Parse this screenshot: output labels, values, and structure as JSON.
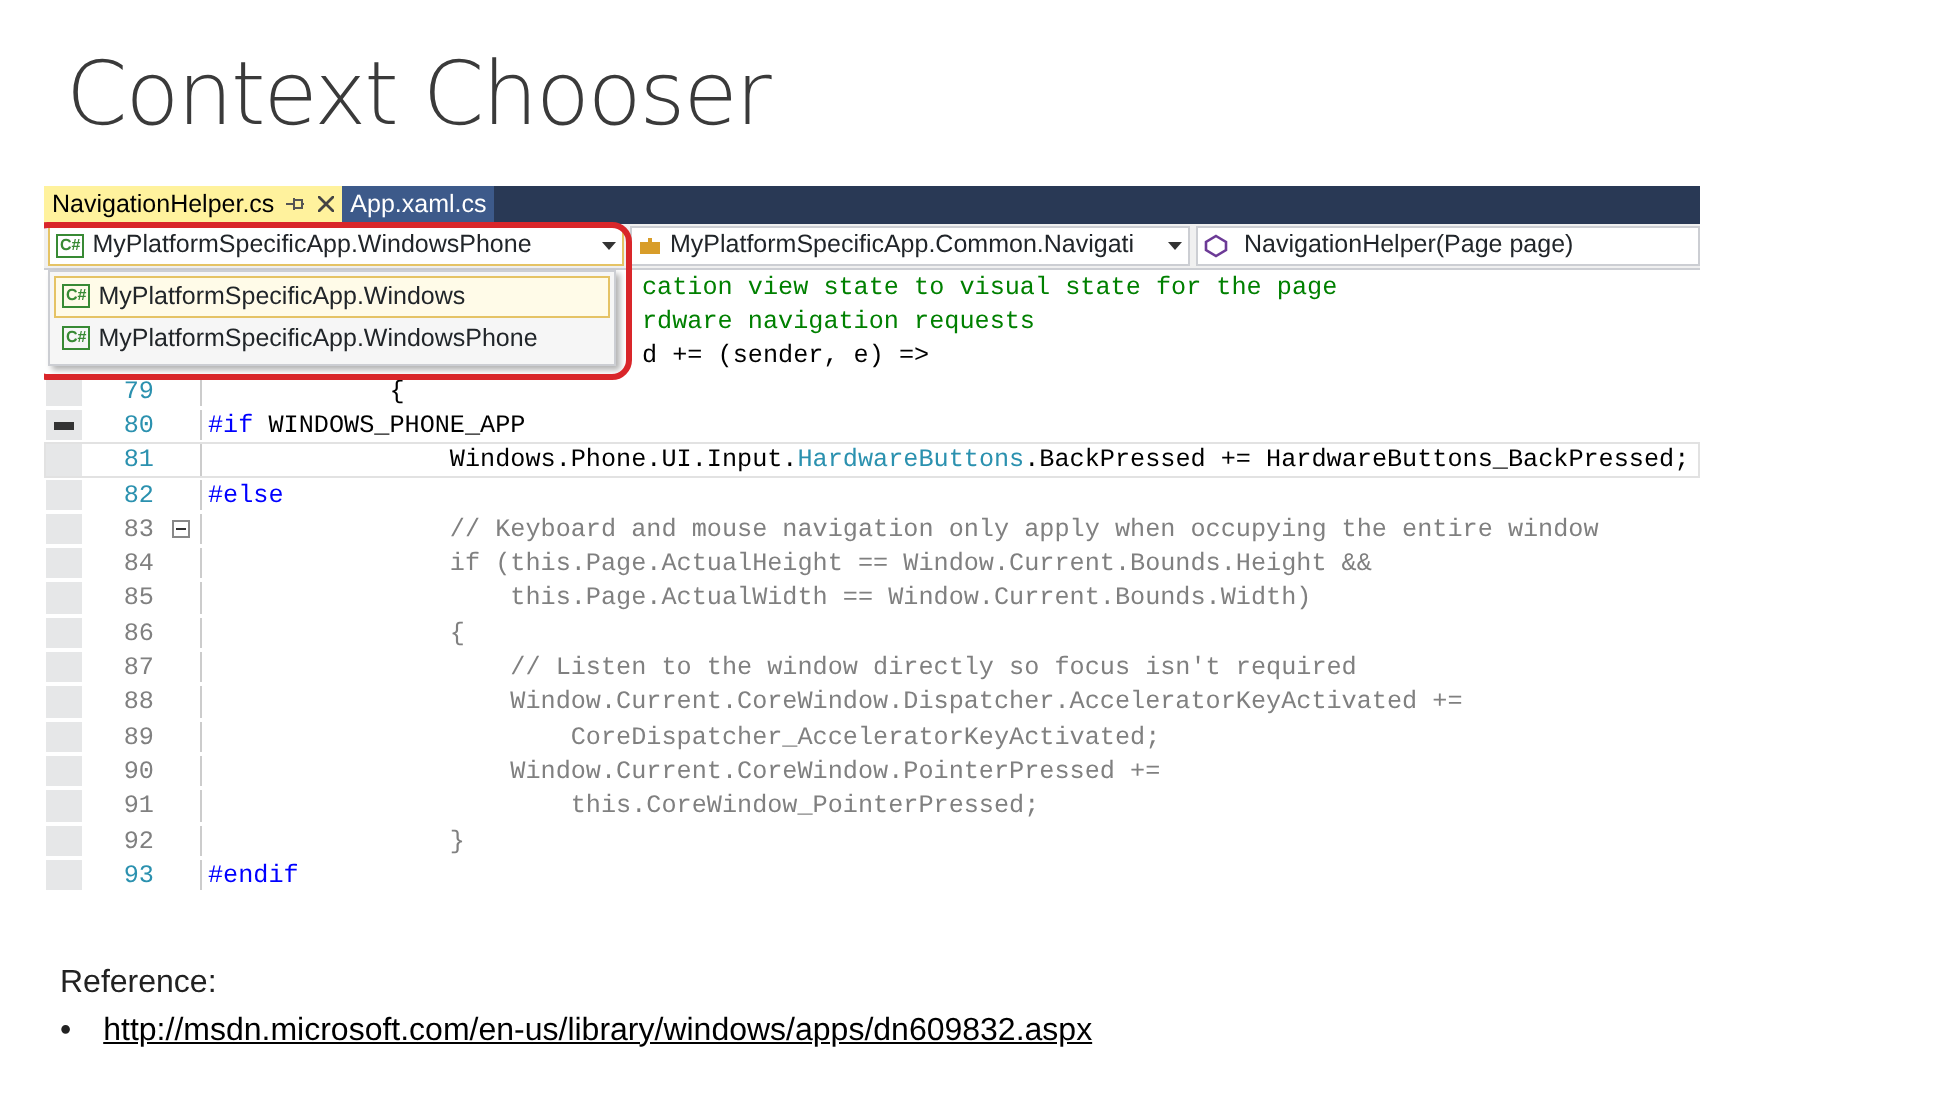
{
  "slide_title": "Context Chooser",
  "editor": {
    "tabs": [
      {
        "label": "NavigationHelper.cs",
        "selected": true,
        "pinnable": true
      },
      {
        "label": "App.xaml.cs",
        "selected": false,
        "pinnable": false
      }
    ],
    "nav_bar": {
      "project": {
        "icon_text": "C#",
        "value": "MyPlatformSpecificApp.WindowsPhone",
        "expanded": true
      },
      "type": {
        "value": "MyPlatformSpecificApp.Common.Navigati"
      },
      "member": {
        "value": "NavigationHelper(Page page)"
      }
    },
    "dropdown": [
      {
        "icon_text": "C#",
        "label": "MyPlatformSpecificApp.Windows",
        "selected": true
      },
      {
        "icon_text": "C#",
        "label": "MyPlatformSpecificApp.WindowsPhone",
        "selected": false
      }
    ],
    "lines": [
      {
        "inactive": false,
        "current": false,
        "tokens": [
          {
            "kind": "comment",
            "text": "cation view state to visual state for the page"
          }
        ]
      },
      {
        "inactive": false,
        "current": false,
        "tokens": [
          {
            "kind": "comment",
            "text": "rdware navigation requests"
          }
        ]
      },
      {
        "inactive": false,
        "current": false,
        "tokens": [
          {
            "kind": "plain",
            "text": "d += (sender, e) =>"
          }
        ]
      },
      {
        "number": "79",
        "inactive": false,
        "current": false,
        "marker": false,
        "fold": false,
        "tokens": [
          {
            "kind": "plain",
            "text": "            {"
          }
        ]
      },
      {
        "number": "80",
        "inactive": false,
        "current": false,
        "marker": true,
        "fold": false,
        "tokens": [
          {
            "kind": "keyword",
            "text": "#if"
          },
          {
            "kind": "plain",
            "text": " WINDOWS_PHONE_APP"
          }
        ]
      },
      {
        "number": "81",
        "inactive": false,
        "current": true,
        "marker": false,
        "fold": false,
        "tokens": [
          {
            "kind": "plain",
            "text": "                Windows.Phone.UI.Input."
          },
          {
            "kind": "type",
            "text": "HardwareButtons"
          },
          {
            "kind": "plain",
            "text": ".BackPressed += HardwareButtons_BackPressed;"
          }
        ]
      },
      {
        "number": "82",
        "inactive": false,
        "current": false,
        "marker": false,
        "fold": false,
        "tokens": [
          {
            "kind": "keyword",
            "text": "#else"
          }
        ]
      },
      {
        "number": "83",
        "inactive": true,
        "current": false,
        "marker": false,
        "fold": true,
        "tokens": [
          {
            "kind": "plain",
            "text": "                // Keyboard and mouse navigation only apply when occupying the entire window"
          }
        ]
      },
      {
        "number": "84",
        "inactive": true,
        "current": false,
        "marker": false,
        "fold": false,
        "tokens": [
          {
            "kind": "plain",
            "text": "                if (this.Page.ActualHeight == Window.Current.Bounds.Height &&"
          }
        ]
      },
      {
        "number": "85",
        "inactive": true,
        "current": false,
        "marker": false,
        "fold": false,
        "tokens": [
          {
            "kind": "plain",
            "text": "                    this.Page.ActualWidth == Window.Current.Bounds.Width)"
          }
        ]
      },
      {
        "number": "86",
        "inactive": true,
        "current": false,
        "marker": false,
        "fold": false,
        "tokens": [
          {
            "kind": "plain",
            "text": "                {"
          }
        ]
      },
      {
        "number": "87",
        "inactive": true,
        "current": false,
        "marker": false,
        "fold": false,
        "tokens": [
          {
            "kind": "plain",
            "text": "                    // Listen to the window directly so focus isn't required"
          }
        ]
      },
      {
        "number": "88",
        "inactive": true,
        "current": false,
        "marker": false,
        "fold": false,
        "tokens": [
          {
            "kind": "plain",
            "text": "                    Window.Current.CoreWindow.Dispatcher.AcceleratorKeyActivated +="
          }
        ]
      },
      {
        "number": "89",
        "inactive": true,
        "current": false,
        "marker": false,
        "fold": false,
        "tokens": [
          {
            "kind": "plain",
            "text": "                        CoreDispatcher_AcceleratorKeyActivated;"
          }
        ]
      },
      {
        "number": "90",
        "inactive": true,
        "current": false,
        "marker": false,
        "fold": false,
        "tokens": [
          {
            "kind": "plain",
            "text": "                    Window.Current.CoreWindow.PointerPressed +="
          }
        ]
      },
      {
        "number": "91",
        "inactive": true,
        "current": false,
        "marker": false,
        "fold": false,
        "tokens": [
          {
            "kind": "plain",
            "text": "                        this.CoreWindow_PointerPressed;"
          }
        ]
      },
      {
        "number": "92",
        "inactive": true,
        "current": false,
        "marker": false,
        "fold": false,
        "tokens": [
          {
            "kind": "plain",
            "text": "                }"
          }
        ]
      },
      {
        "number": "93",
        "inactive": false,
        "current": false,
        "marker": false,
        "fold": false,
        "tokens": [
          {
            "kind": "keyword",
            "text": "#endif"
          }
        ]
      }
    ]
  },
  "reference": {
    "label": "Reference:",
    "items": [
      {
        "bullet": "•",
        "link": "http://msdn.microsoft.com/en-us/library/windows/apps/dn609832.aspx"
      }
    ]
  }
}
